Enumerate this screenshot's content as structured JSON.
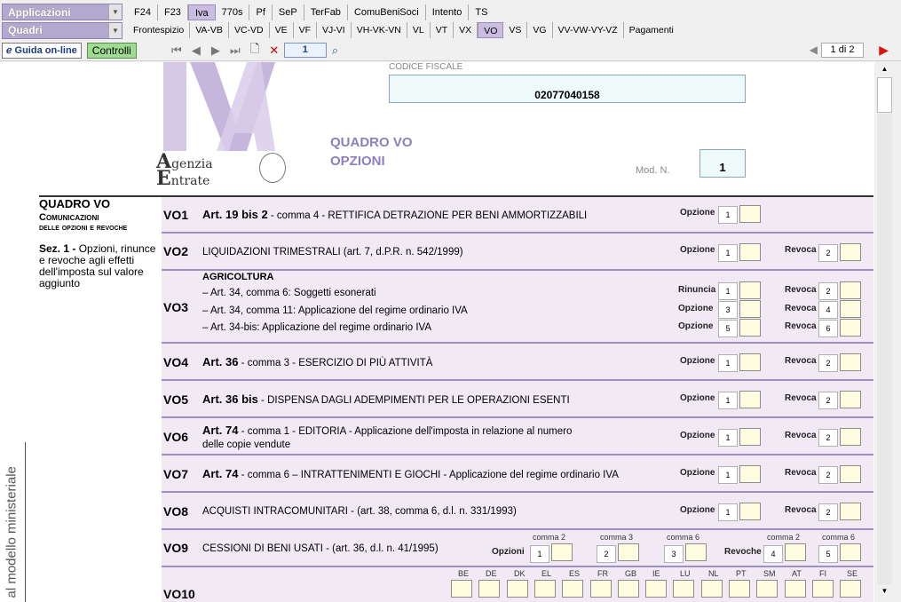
{
  "menu": {
    "apps_label": "Applicazioni",
    "quadri_label": "Quadri",
    "row1_tabs": [
      "F24",
      "F23",
      "Iva",
      "770s",
      "Pf",
      "SeP",
      "TerFab",
      "ComuBeniSoci",
      "Intento",
      "TS"
    ],
    "row1_active": "Iva",
    "row2_tabs": [
      "Frontespizio",
      "VA-VB",
      "VC-VD",
      "VE",
      "VF",
      "VJ-VI",
      "VH-VK-VN",
      "VL",
      "VT",
      "VX",
      "VO",
      "VS",
      "VG",
      "VV-VW-VY-VZ",
      "Pagamenti"
    ],
    "row2_active": "VO"
  },
  "toolbar": {
    "guide_label": "Guida on-line",
    "controls_label": "Controlli",
    "page_value": "1",
    "page_count": "1 di 2"
  },
  "header": {
    "logo_text": "genzia\nntrate",
    "cf_label": "CODICE FISCALE",
    "cf_value": "02077040158",
    "quadro_title_1": "QUADRO VO",
    "quadro_title_2": "OPZIONI",
    "modn_label": "Mod. N.",
    "modn_value": "1"
  },
  "side": {
    "title": "QUADRO VO",
    "sub1": "Comunicazioni",
    "sub2": "delle opzioni e revoche",
    "sec_bold": "Sez. 1 -",
    "sec_text": " Opzioni, rinunce e revoche agli effetti dell'imposta sul valore aggiunto",
    "vertical": "al modello ministeriale"
  },
  "rows": {
    "vo1": {
      "code": "VO1",
      "bold": "Art. 19 bis 2",
      "text": " - comma 4 - RETTIFICA DETRAZIONE PER BENI AMMORTIZZABILI",
      "l1": "Opzione",
      "n1": "1"
    },
    "vo2": {
      "code": "VO2",
      "text": "LIQUIDAZIONI TRIMESTRALI  (art. 7, d.P.R. n. 542/1999)",
      "l1": "Opzione",
      "n1": "1",
      "l2": "Revoca",
      "n2": "2"
    },
    "vo3": {
      "code": "VO3",
      "head": "AGRICOLTURA",
      "s1": "– Art. 34, comma   6: Soggetti esonerati",
      "s2": "– Art. 34, comma 11: Applicazione del regime ordinario IVA",
      "s3": "– Art. 34-bis: Applicazione del regime ordinario IVA",
      "a1": "Rinuncia",
      "a2": "Opzione",
      "a3": "Opzione",
      "b": "Revoca",
      "n": [
        "1",
        "2",
        "3",
        "4",
        "5",
        "6"
      ]
    },
    "vo4": {
      "code": "VO4",
      "bold": "Art. 36",
      "text": " - comma 3 - ESERCIZIO DI PIÙ ATTIVITÀ",
      "l1": "Opzione",
      "n1": "1",
      "l2": "Revoca",
      "n2": "2"
    },
    "vo5": {
      "code": "VO5",
      "bold": "Art. 36 bis",
      "text": " - DISPENSA DAGLI ADEMPIMENTI PER LE OPERAZIONI ESENTI",
      "l1": "Opzione",
      "n1": "1",
      "l2": "Revoca",
      "n2": "2"
    },
    "vo6": {
      "code": "VO6",
      "bold": "Art. 74",
      "text": " - comma 1 - EDITORIA - Applicazione dell'imposta in relazione al numero",
      "text2": "delle copie vendute",
      "l1": "Opzione",
      "n1": "1",
      "l2": "Revoca",
      "n2": "2"
    },
    "vo7": {
      "code": "VO7",
      "bold": "Art. 74",
      "text": " - comma    6 – INTRATTENIMENTI E GIOCHI - Applicazione del regime ordinario IVA",
      "l1": "Opzione",
      "n1": "1",
      "l2": "Revoca",
      "n2": "2"
    },
    "vo8": {
      "code": "VO8",
      "text": "ACQUISTI INTRACOMUNITARI - (art. 38, comma 6, d.l. n. 331/1993)",
      "l1": "Opzione",
      "n1": "1",
      "l2": "Revoca",
      "n2": "2"
    },
    "vo9": {
      "code": "VO9",
      "text": "CESSIONI DI BENI USATI - (art. 36, d.l. n. 41/1995)",
      "opz": "Opzioni",
      "rev": "Revoche",
      "c1": "comma 2",
      "c2": "comma 3",
      "c3": "comma 6",
      "c4": "comma 2",
      "c5": "comma 6",
      "n": [
        "1",
        "2",
        "3",
        "4",
        "5"
      ]
    },
    "vo10": {
      "code": "VO10",
      "countries": [
        "BE",
        "DE",
        "DK",
        "EL",
        "ES",
        "FR",
        "GB",
        "IE",
        "LU",
        "NL",
        "PT",
        "SM",
        "AT",
        "FI",
        "SE"
      ]
    }
  }
}
